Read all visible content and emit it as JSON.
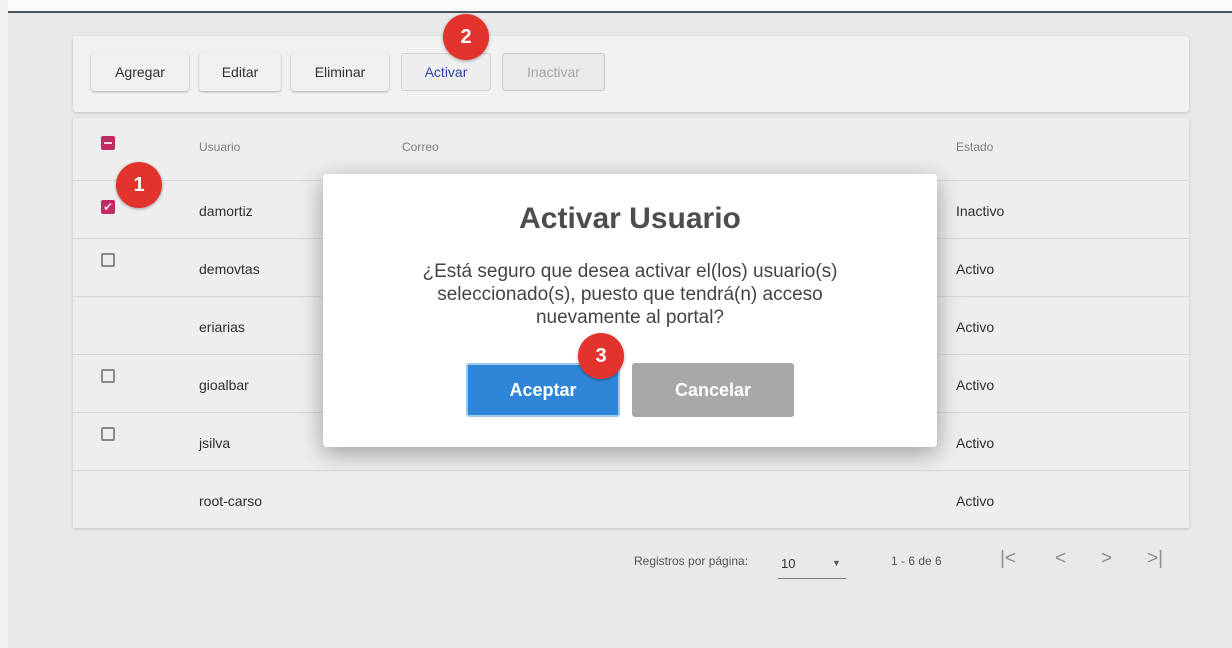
{
  "toolbar": {
    "add_label": "Agregar",
    "edit_label": "Editar",
    "delete_label": "Eliminar",
    "activate_label": "Activar",
    "deactivate_label": "Inactivar"
  },
  "table": {
    "columns": {
      "user": "Usuario",
      "email": "Correo",
      "status": "Estado"
    },
    "rows": [
      {
        "user": "damortiz",
        "status": "Inactivo",
        "checkbox": "checked"
      },
      {
        "user": "demovtas",
        "status": "Activo",
        "checkbox": "unchecked"
      },
      {
        "user": "eriarias",
        "status": "Activo",
        "checkbox": "none"
      },
      {
        "user": "gioalbar",
        "status": "Activo",
        "checkbox": "unchecked"
      },
      {
        "user": "jsilva",
        "status": "Activo",
        "checkbox": "unchecked"
      },
      {
        "user": "root-carso",
        "status": "Activo",
        "checkbox": "none"
      }
    ]
  },
  "pagination": {
    "rows_per_page_label": "Registros por página:",
    "rows_per_page_value": "10",
    "range": "1 - 6 de 6",
    "first_icon": "|<",
    "prev_icon": "<",
    "next_icon": ">",
    "last_icon": ">|",
    "dropdown_icon": "▼"
  },
  "dialog": {
    "title": "Activar Usuario",
    "message": "¿Está seguro que desea activar el(los) usuario(s) seleccionado(s), puesto que tendrá(n) acceso nuevamente al portal?",
    "accept_label": "Aceptar",
    "cancel_label": "Cancelar"
  },
  "badges": {
    "step1": "1",
    "step2": "2",
    "step3": "3"
  },
  "colors": {
    "checkbox_accent": "#c22a63",
    "accept_button": "#2f86d9",
    "cancel_button": "#a8a8a8",
    "badge": "#e2332d",
    "primary_text": "#2f45a8"
  },
  "icons": {
    "checkbox_checked": "✔"
  }
}
